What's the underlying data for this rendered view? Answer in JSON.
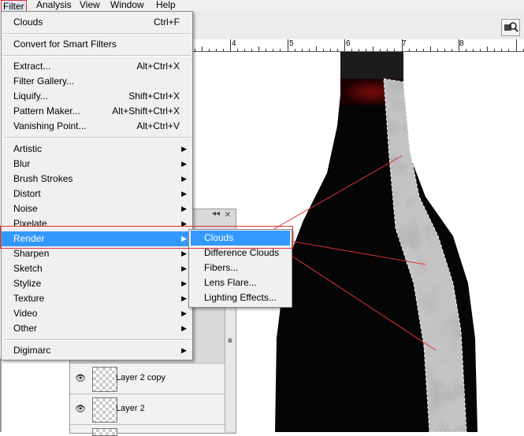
{
  "menubar": {
    "items": [
      {
        "label": "Filter"
      },
      {
        "label": "Analysis"
      },
      {
        "label": "View"
      },
      {
        "label": "Window"
      },
      {
        "label": "Help"
      }
    ]
  },
  "ruler": {
    "numbers": [
      "4",
      "5",
      "6",
      "7",
      "8"
    ]
  },
  "filter_menu": {
    "items": [
      {
        "label": "Clouds",
        "shortcut": "Ctrl+F"
      },
      {
        "label": "Convert for Smart Filters",
        "shortcut": ""
      },
      {
        "label": "Extract...",
        "shortcut": "Alt+Ctrl+X"
      },
      {
        "label": "Filter Gallery...",
        "shortcut": ""
      },
      {
        "label": "Liquify...",
        "shortcut": "Shift+Ctrl+X"
      },
      {
        "label": "Pattern Maker...",
        "shortcut": "Alt+Shift+Ctrl+X"
      },
      {
        "label": "Vanishing Point...",
        "shortcut": "Alt+Ctrl+V"
      },
      {
        "label": "Artistic"
      },
      {
        "label": "Blur"
      },
      {
        "label": "Brush Strokes"
      },
      {
        "label": "Distort"
      },
      {
        "label": "Noise"
      },
      {
        "label": "Pixelate"
      },
      {
        "label": "Render"
      },
      {
        "label": "Sharpen"
      },
      {
        "label": "Sketch"
      },
      {
        "label": "Stylize"
      },
      {
        "label": "Texture"
      },
      {
        "label": "Video"
      },
      {
        "label": "Other"
      },
      {
        "label": "Digimarc"
      }
    ]
  },
  "render_submenu": {
    "items": [
      {
        "label": "Clouds"
      },
      {
        "label": "Difference Clouds"
      },
      {
        "label": "Fibers..."
      },
      {
        "label": "Lens Flare..."
      },
      {
        "label": "Lighting Effects..."
      }
    ]
  },
  "layers": {
    "rows": [
      {
        "name": "Layer 2 copy"
      },
      {
        "name": "Layer 2"
      }
    ]
  },
  "icons": {
    "submenu_arrow": "arrow-right-icon",
    "eye": "eye-icon",
    "zoom": "zoom-tool-icon"
  },
  "colors": {
    "menu_highlight": "#3399ff",
    "annotation": "#e03030",
    "bottle": "#050505",
    "neck_accent": "#5a0a0a"
  }
}
